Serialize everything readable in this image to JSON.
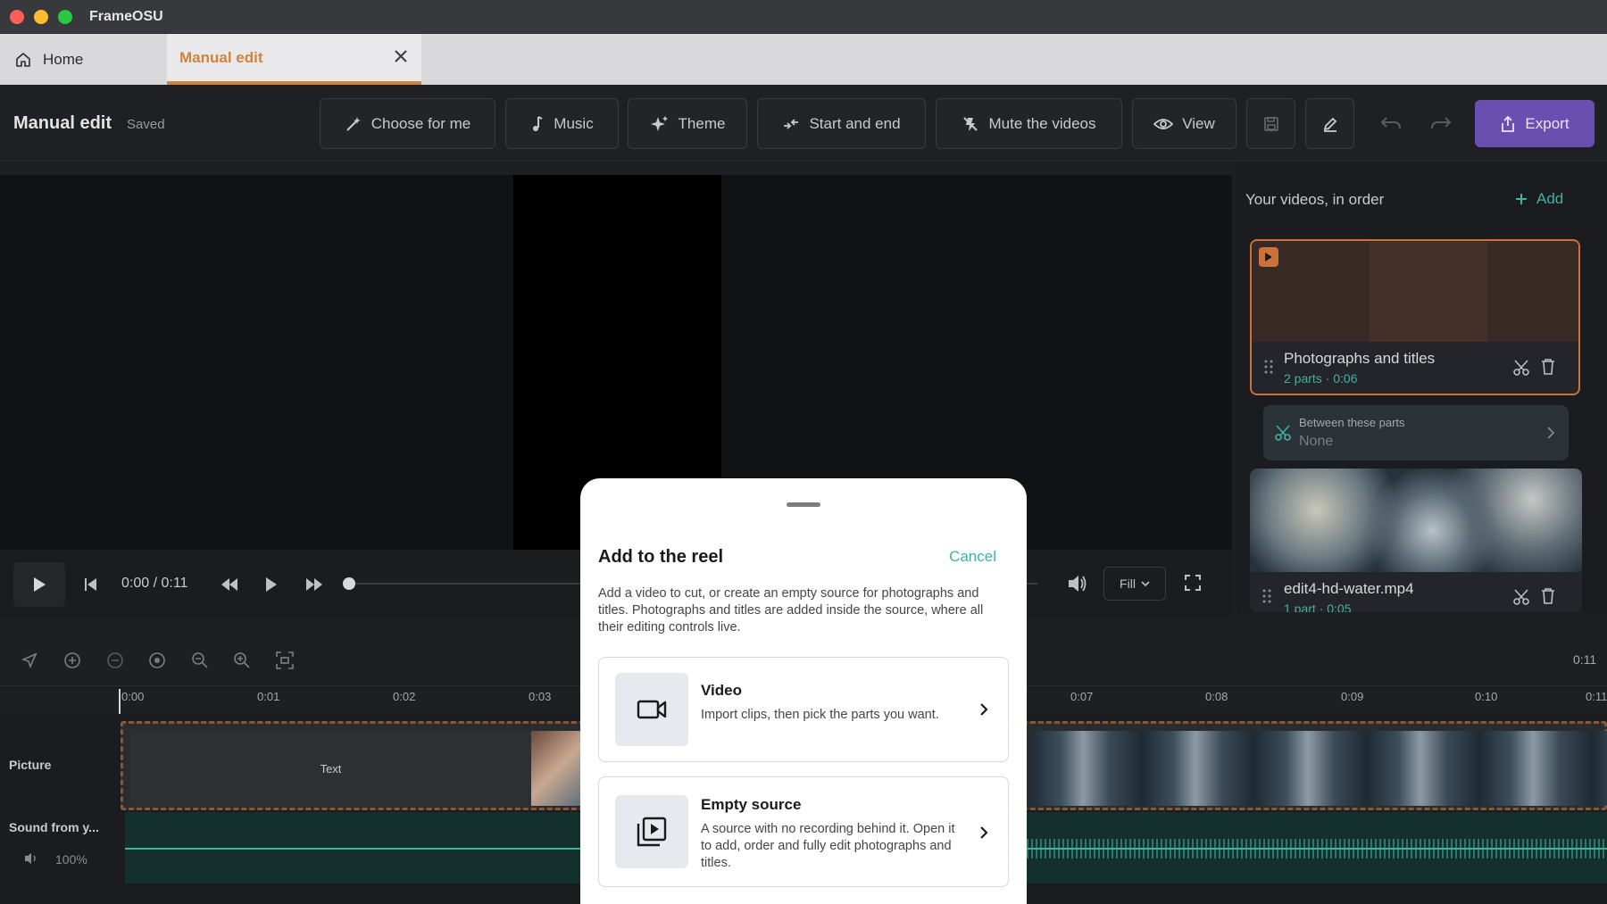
{
  "window": {
    "title": "FrameOSU"
  },
  "tabs": {
    "home": "Home",
    "active": "Manual edit"
  },
  "toolbar": {
    "title": "Manual edit",
    "status": "Saved",
    "buttons": [
      "Choose for me",
      "Music",
      "Theme",
      "Start and end",
      "Mute the videos",
      "View"
    ],
    "export": "Export"
  },
  "player": {
    "timecode": "0:00 / 0:11",
    "fit": "Fill"
  },
  "timeline": {
    "end_time": "0:11",
    "ticks": [
      "0:00",
      "0:01",
      "0:02",
      "0:03",
      "0:07",
      "0:08",
      "0:09",
      "0:10",
      "0:11"
    ],
    "picture_label": "Picture",
    "text_clip": "Text",
    "sound_label": "Sound from y...",
    "volume": "100%"
  },
  "sidebar": {
    "title": "Your videos, in order",
    "add": "Add",
    "items": [
      {
        "name": "Photographs and titles",
        "meta": "2 parts · 0:06"
      },
      {
        "name": "edit4-hd-water.mp4",
        "meta": "1 part · 0:05"
      }
    ],
    "between": {
      "label": "Between these parts",
      "value": "None"
    }
  },
  "sheet": {
    "title": "Add to the reel",
    "cancel": "Cancel",
    "description": "Add a video to cut, or create an empty source for photographs and titles. Photographs and titles are added inside the source, where all their editing controls live.",
    "options": [
      {
        "title": "Video",
        "description": "Import clips, then pick the parts you want."
      },
      {
        "title": "Empty source",
        "description": "A source with no recording behind it. Open it to add, order and fully edit photographs and titles."
      }
    ]
  },
  "colors": {
    "accent": "#d4823f",
    "export": "#6b4fb0",
    "teal": "#3fb2a2"
  }
}
